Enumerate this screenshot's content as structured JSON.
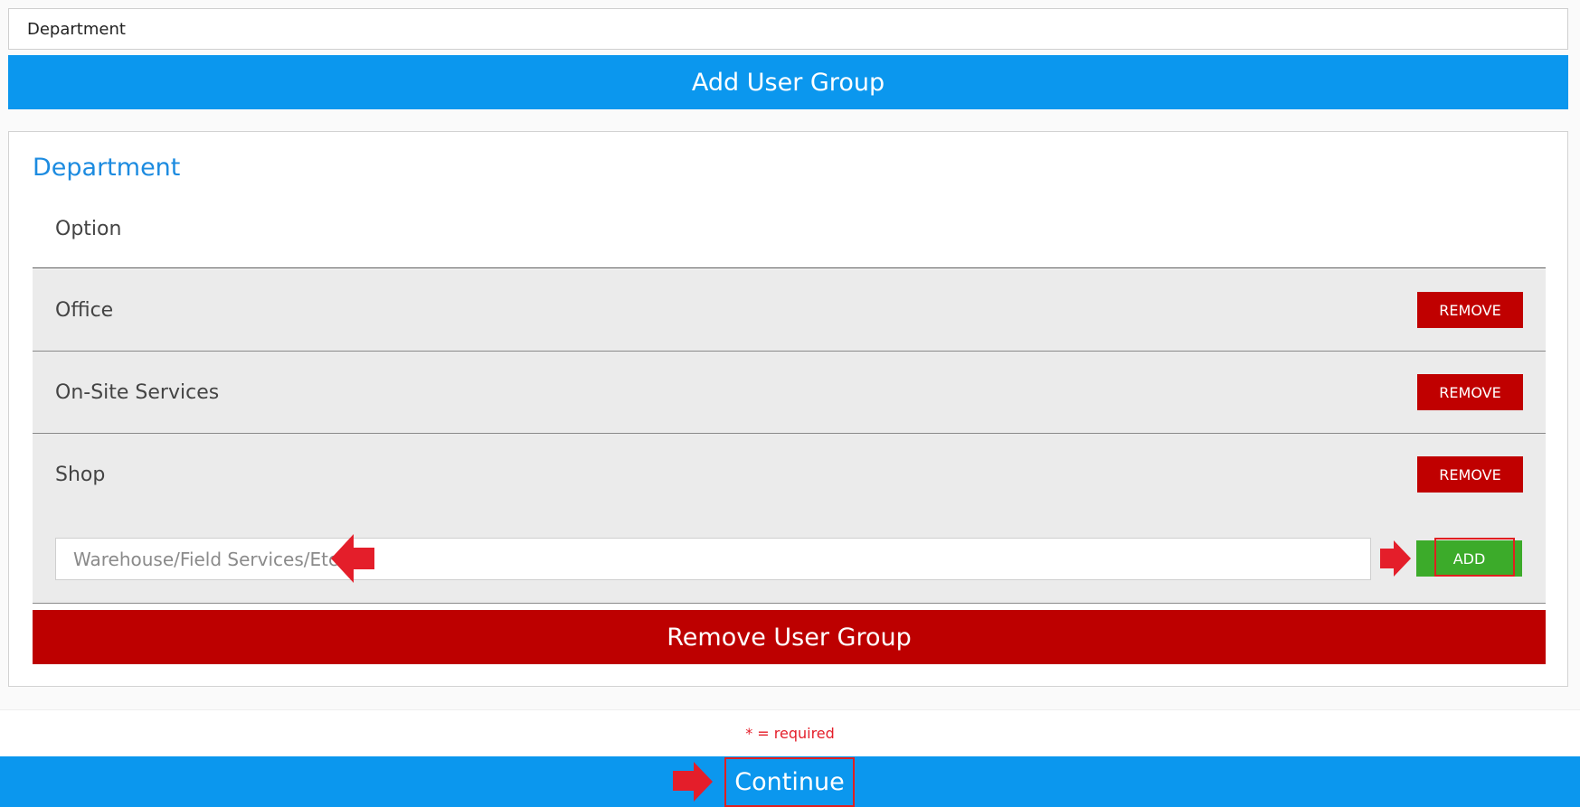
{
  "top_field": {
    "value": "Department"
  },
  "add_user_group": {
    "label": "Add User Group"
  },
  "group": {
    "title": "Department",
    "header": "Option",
    "options": [
      {
        "label": "Office",
        "remove_label": "REMOVE"
      },
      {
        "label": "On-Site Services",
        "remove_label": "REMOVE"
      },
      {
        "label": "Shop",
        "remove_label": "REMOVE"
      }
    ],
    "new_option_placeholder": "Warehouse/Field Services/Etc.",
    "add_label": "ADD",
    "remove_group_label": "Remove User Group"
  },
  "required_note": "* = required",
  "continue_label": "Continue",
  "colors": {
    "primary_blue": "#0b97ee",
    "title_blue": "#1c8be0",
    "remove_red": "#c00000",
    "add_green": "#3cab2a",
    "annotation_red": "#e41e2a"
  }
}
